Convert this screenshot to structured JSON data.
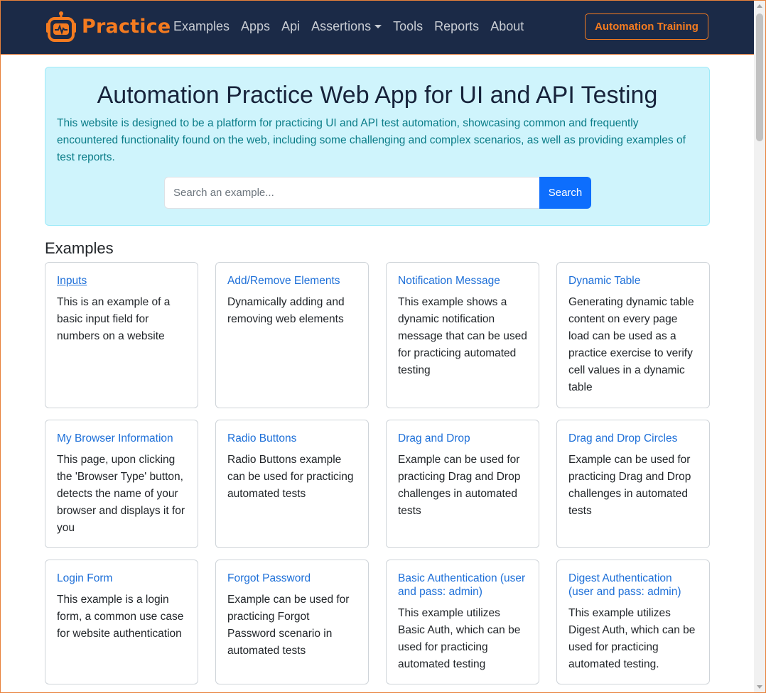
{
  "navbar": {
    "brand": "Practice",
    "links": [
      {
        "label": "Examples"
      },
      {
        "label": "Apps"
      },
      {
        "label": "Api"
      },
      {
        "label": "Assertions"
      },
      {
        "label": "Tools"
      },
      {
        "label": "Reports"
      },
      {
        "label": "About"
      }
    ],
    "cta_label": "Automation Training"
  },
  "hero": {
    "title": "Automation Practice Web App for UI and API Testing",
    "description": "This website is designed to be a platform for practicing UI and API test automation, showcasing common and frequently encountered functionality found on the web, including some challenging and complex scenarios, as well as providing examples of test reports.",
    "search_placeholder": "Search an example...",
    "search_button": "Search"
  },
  "examples": {
    "heading": "Examples",
    "cards": [
      {
        "title": "Inputs",
        "text": "This is an example of a basic input field for numbers on a website"
      },
      {
        "title": "Add/Remove Elements",
        "text": "Dynamically adding and removing web elements"
      },
      {
        "title": "Notification Message",
        "text": "This example shows a dynamic notification message that can be used for practicing automated testing"
      },
      {
        "title": "Dynamic Table",
        "text": "Generating dynamic table content on every page load can be used as a practice exercise to verify cell values in a dynamic table"
      },
      {
        "title": "My Browser Information",
        "text": "This page, upon clicking the 'Browser Type' button, detects the name of your browser and displays it for you"
      },
      {
        "title": "Radio Buttons",
        "text": "Radio Buttons example can be used for practicing automated tests"
      },
      {
        "title": "Drag and Drop",
        "text": "Example can be used for practicing Drag and Drop challenges in automated tests"
      },
      {
        "title": "Drag and Drop Circles",
        "text": "Example can be used for practicing Drag and Drop challenges in automated tests"
      },
      {
        "title": "Login Form",
        "text": "This example is a login form, a common use case for website authentication"
      },
      {
        "title": "Forgot Password",
        "text": "Example can be used for practicing Forgot Password scenario in automated tests"
      },
      {
        "title": "Basic Authentication (user and pass: admin)",
        "text": "This example utilizes Basic Auth, which can be used for practicing automated testing"
      },
      {
        "title": "Digest Authentication (user and pass: admin)",
        "text": "This example utilizes Digest Auth, which can be used for practicing automated testing."
      }
    ]
  },
  "colors": {
    "navbar_bg": "#1b2a47",
    "brand_orange": "#f47b20",
    "hero_bg": "#cff4fc",
    "link_blue": "#1d6fd8",
    "primary_button": "#0d6efd"
  }
}
